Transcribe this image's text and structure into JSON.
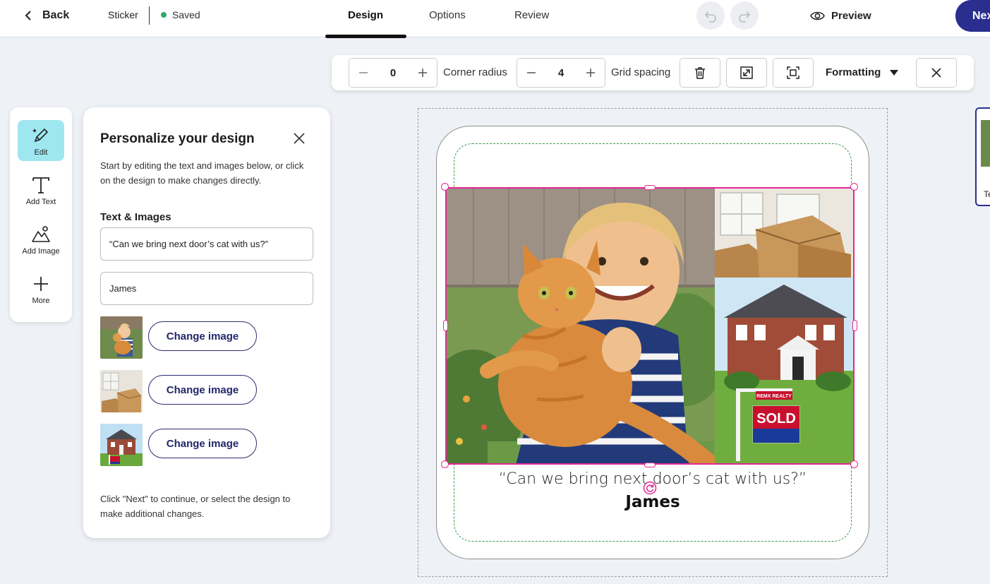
{
  "topbar": {
    "back_label": "Back",
    "product": "Sticker",
    "status": "Saved",
    "tabs": [
      "Design",
      "Options",
      "Review"
    ],
    "preview_label": "Preview",
    "next_label": "Next"
  },
  "format_bar": {
    "value_1": "0",
    "corner_radius_label": "Corner radius",
    "corner_radius_value": "4",
    "grid_spacing_label": "Grid spacing",
    "formatting_label": "Formatting"
  },
  "rail": {
    "items": [
      "Edit",
      "Add Text",
      "Add Image",
      "More"
    ]
  },
  "panel": {
    "title": "Personalize your design",
    "intro": "Start by editing the text and images below, or click on the design to make changes directly.",
    "section_title": "Text & Images",
    "text_fields": [
      "“Can we bring next door’s cat with us?”",
      "James"
    ],
    "change_image_label": "Change image",
    "outro": "Click \"Next\" to continue, or select the design to make additional changes."
  },
  "design": {
    "quote": "“Can we bring next door’s cat with us?”",
    "name": "James",
    "sign_brand": "REMX REALTY",
    "sign_text": "SOLD"
  },
  "right_strip": {
    "label": "Te"
  },
  "colors": {
    "accent": "#2a2e8f",
    "selection": "#e02a95",
    "safe_area": "#3a9a4a",
    "active_tool": "#9ee6f0",
    "saved_dot": "#2eaa5e"
  }
}
